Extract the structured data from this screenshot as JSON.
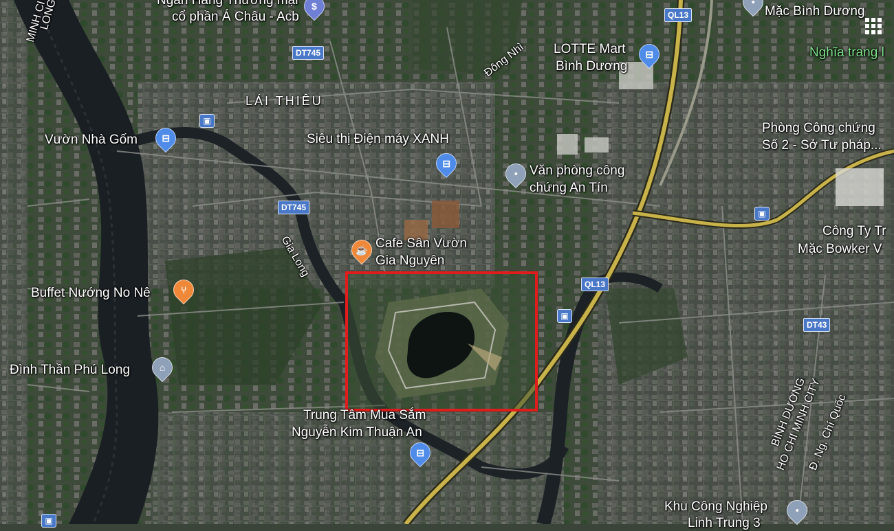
{
  "map": {
    "highlight_color": "#e01c1c",
    "labels": {
      "top_bank": "Ngân Hàng Thương mại",
      "top_bank2": "cổ phần Á Châu - Acb",
      "mac_binh_duong": "Mặc Bình Dương",
      "river_city": "MINH CITY",
      "river_long": "LONG",
      "dong_nhi": "Đông Nhì",
      "lotte_1": "LOTTE Mart",
      "lotte_2": "Bình Dương",
      "nghia_trang": "Nghĩa trang l",
      "lai_thieu": "LÁI THIÊU",
      "vuon_nha_gom": "Vườn Nhà Gốm",
      "sieu_thi": "Siêu thị Điện máy XANH",
      "van_phong_1": "Văn phòng công",
      "van_phong_2": "chứng An Tín",
      "phong_cong_chung_1": "Phòng Công chứng",
      "phong_cong_chung_2": "Số 2 - Sở Tư pháp...",
      "cong_ty_1": "Công Ty Tr",
      "cong_ty_2": "Mặc Bowker V",
      "gia_long": "Gia Long",
      "cafe_1": "Cafe Sân Vườn",
      "cafe_2": "Gia Nguyên",
      "buffet": "Buffet Nướng No Nê",
      "dinh_than": "Đình Thần Phú Long",
      "trung_tam_1": "Trung Tâm Mua Sắm",
      "trung_tam_2": "Nguyễn Kim Thuận An",
      "binh_duong_border": "BÌNH DƯƠNG",
      "hcm_border": "HO CHI MINH CITY",
      "ng_chi_quoc": "Đ. Ng. Chí Quốc",
      "khu_cong_nghiep_1": "Khu Công Nghiệp",
      "khu_cong_nghiep_2": "Linh Trung 3"
    },
    "shields": {
      "ql13_top": "QL13",
      "ql13_mid": "QL13",
      "dt745_top": "DT745",
      "dt745_mid": "DT745",
      "dt43": "DT43"
    },
    "icons": {
      "shopping": "shopping-bag-icon",
      "bank": "bank-icon",
      "cafe": "cafe-icon",
      "restaurant": "restaurant-icon",
      "place": "place-pin-icon",
      "temple": "temple-icon",
      "bus": "bus-stop-icon",
      "grid": "grid-menu-icon"
    }
  }
}
